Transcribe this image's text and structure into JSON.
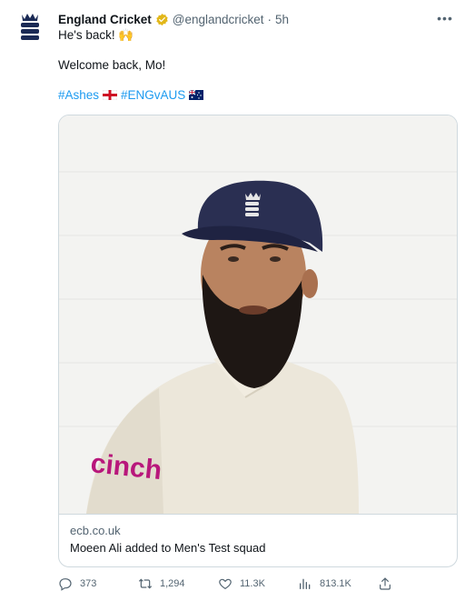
{
  "tweet": {
    "display_name": "England Cricket",
    "handle": "@englandcricket",
    "separator": "·",
    "time": "5h",
    "more_label": "•••",
    "line1": "He's back! 🙌",
    "line2": "Welcome back, Mo!",
    "hashtags": [
      "#Ashes",
      "#ENGvAUS"
    ],
    "flag_icons": [
      "england-flag-icon",
      "australia-flag-icon"
    ]
  },
  "card": {
    "domain": "ecb.co.uk",
    "title": "Moeen Ali added to Men's Test squad",
    "jersey_text": "cinch"
  },
  "actions": {
    "replies": "373",
    "retweets": "1,294",
    "likes": "11.3K",
    "views": "813.1K"
  },
  "colors": {
    "link": "#1d9bf0",
    "secondary_text": "#536471",
    "verified_gold": "#e2b719",
    "ecb_navy": "#1b2a55"
  }
}
